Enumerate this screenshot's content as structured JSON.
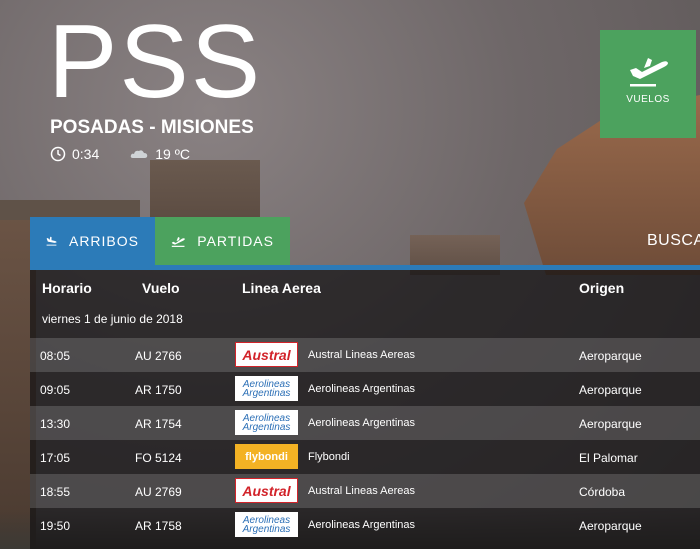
{
  "airport": {
    "code": "PSS",
    "city": "POSADAS - MISIONES",
    "time": "0:34",
    "temperature": "19 ºC"
  },
  "nav": {
    "vuelos_label": "VUELOS"
  },
  "tabs": {
    "arribos": "ARRIBOS",
    "partidas": "PARTIDAS",
    "buscar": "BUSCA"
  },
  "table": {
    "headers": {
      "time": "Horario",
      "flight": "Vuelo",
      "airline": "Linea Aerea",
      "origin": "Origen"
    },
    "date": "viernes 1 de junio de 2018",
    "rows": [
      {
        "time": "08:05",
        "flight": "AU 2766",
        "logo": "Austral",
        "airline": "Austral Lineas Aereas",
        "origin": "Aeroparque"
      },
      {
        "time": "09:05",
        "flight": "AR 1750",
        "logo": "Aerolineas Argentinas",
        "airline": "Aerolineas Argentinas",
        "origin": "Aeroparque"
      },
      {
        "time": "13:30",
        "flight": "AR 1754",
        "logo": "Aerolineas Argentinas",
        "airline": "Aerolineas Argentinas",
        "origin": "Aeroparque"
      },
      {
        "time": "17:05",
        "flight": "FO 5124",
        "logo": "flybondi",
        "airline": "Flybondi",
        "origin": "El Palomar"
      },
      {
        "time": "18:55",
        "flight": "AU 2769",
        "logo": "Austral",
        "airline": "Austral Lineas Aereas",
        "origin": "Córdoba"
      },
      {
        "time": "19:50",
        "flight": "AR 1758",
        "logo": "Aerolineas Argentinas",
        "airline": "Aerolineas Argentinas",
        "origin": "Aeroparque"
      }
    ]
  },
  "colors": {
    "arribos": "#2c7bb8",
    "partidas": "#4ca25e",
    "austral": "#d2232a",
    "flybondi": "#f3b224"
  }
}
